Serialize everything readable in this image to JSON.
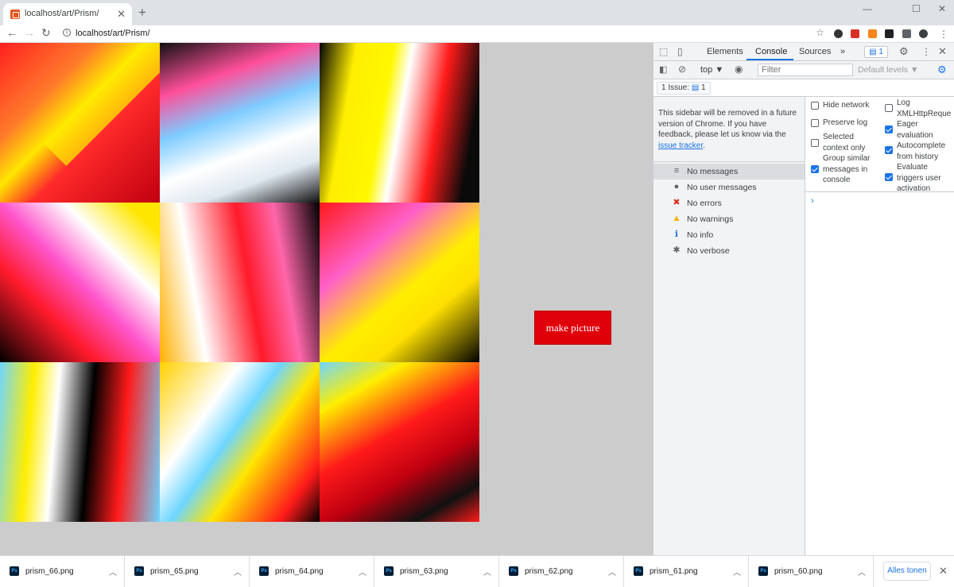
{
  "browser": {
    "tab_title": "localhost/art/Prism/",
    "tab_close": "✕",
    "new_tab": "+",
    "url": "localhost/art/Prism/",
    "window_controls": [
      "—",
      "☐",
      "✕"
    ]
  },
  "page": {
    "button_label": "make picture",
    "button_color": "#e0000a",
    "background_color": "#cccccc",
    "palette": [
      "#ff1a1a",
      "#ffee00",
      "#000000",
      "#ffffff",
      "#6fd6ff",
      "#ff4fd8"
    ]
  },
  "devtools": {
    "tabs": [
      "Elements",
      "Console",
      "Sources"
    ],
    "active_tab": "Console",
    "more_tabs": "»",
    "issues_badge": "1",
    "context": "top ▼",
    "filter_placeholder": "Filter",
    "levels": "Default levels ▼",
    "issues_label": "1 Issue:",
    "issues_count": "1",
    "notice_text": "This sidebar will be removed in a future version of Chrome. If you have feedback, please let us know via the",
    "notice_link": "issue tracker",
    "notice_end": ".",
    "sidebar_items": [
      {
        "label": "No messages",
        "icon": "list-icon"
      },
      {
        "label": "No user messages",
        "icon": "user-icon"
      },
      {
        "label": "No errors",
        "icon": "error-icon"
      },
      {
        "label": "No warnings",
        "icon": "warning-icon"
      },
      {
        "label": "No info",
        "icon": "info-icon"
      },
      {
        "label": "No verbose",
        "icon": "bug-icon"
      }
    ],
    "settings_left": [
      {
        "label": "Hide network",
        "checked": false
      },
      {
        "label": "Preserve log",
        "checked": false
      },
      {
        "label": "Selected context only",
        "checked": false
      },
      {
        "label": "Group similar messages in console",
        "checked": true
      }
    ],
    "settings_right": [
      {
        "label": "Log XMLHttpReque",
        "checked": false
      },
      {
        "label": "Eager evaluation",
        "checked": true
      },
      {
        "label": "Autocomplete from history",
        "checked": true
      },
      {
        "label": "Evaluate triggers user activation",
        "checked": true
      }
    ],
    "prompt": "›"
  },
  "downloads": {
    "files": [
      "prism_66.png",
      "prism_65.png",
      "prism_64.png",
      "prism_63.png",
      "prism_62.png",
      "prism_61.png",
      "prism_60.png"
    ],
    "file_icon_text": "Ps",
    "show_all": "Alles tonen",
    "close": "✕"
  }
}
